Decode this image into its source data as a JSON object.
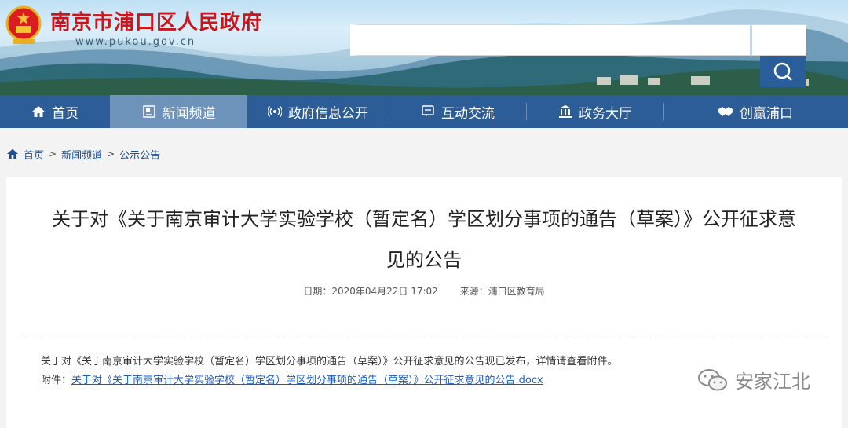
{
  "header": {
    "site_title": "南京市浦口区人民政府",
    "site_url": "www.pukou.gov.cn",
    "search_placeholder": ""
  },
  "nav": {
    "items": [
      {
        "label": "首页",
        "icon": "home-icon"
      },
      {
        "label": "新闻频道",
        "icon": "news-icon",
        "active": true
      },
      {
        "label": "政府信息公开",
        "icon": "broadcast-icon"
      },
      {
        "label": "互动交流",
        "icon": "chat-icon"
      },
      {
        "label": "政务大厅",
        "icon": "hall-icon"
      },
      {
        "label": "创赢浦口",
        "icon": "handshake-icon"
      }
    ]
  },
  "breadcrumb": {
    "items": [
      "首页",
      "新闻频道",
      "公示公告"
    ],
    "separator": ">"
  },
  "article": {
    "title_line1": "关于对《关于南京审计大学实验学校（暂定名）学区划分事项的通告（草案）》公开征求意",
    "title_line2": "见的公告",
    "date": "日期：2020年04月22日 17:02",
    "source": "来源：浦口区教育局",
    "body": "关于对《关于南京审计大学实验学校（暂定名）学区划分事项的通告（草案）》公开征求意见的公告现已发布，详情请查看附件。",
    "attachment_label": "附件：",
    "attachment_link": "关于对《关于南京审计大学实验学校（暂定名）学区划分事项的通告（草案）》公开征求意见的公告.docx"
  },
  "watermark": {
    "text": "安家江北"
  },
  "colors": {
    "nav_bg": "#2d5d96",
    "nav_active": "#6e93bb",
    "title_red": "#c8161d",
    "link_blue": "#1a5bbf"
  }
}
